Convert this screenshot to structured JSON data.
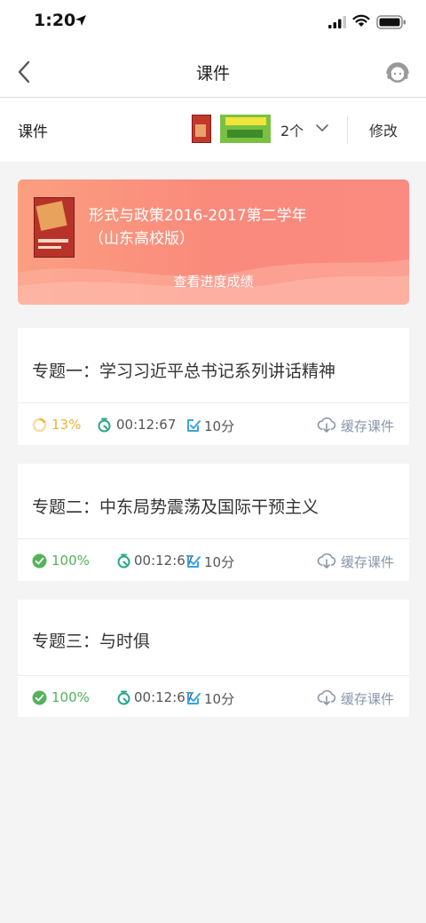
{
  "status_bar": {
    "time": "1:20"
  },
  "nav": {
    "title": "课件"
  },
  "course_bar": {
    "label": "课件",
    "count": "2个",
    "edit_label": "修改"
  },
  "banner": {
    "title_line1": "形式与政策2016-2017第二学年",
    "title_line2": "（山东高校版）",
    "link_text": "查看进度成绩"
  },
  "topics": [
    {
      "title": "专题一：学习习近平总书记系列讲话精神",
      "progress": "13%",
      "duration": "00:12:67",
      "score": "10分",
      "cache_label": "缓存课件"
    },
    {
      "title": "专题二：中东局势震荡及国际干预主义",
      "progress": "100%",
      "duration": "00:12:67",
      "score": "10分",
      "cache_label": "缓存课件"
    },
    {
      "title": "专题三：与时俱",
      "progress": "100%",
      "duration": "00:12:67",
      "score": "10分",
      "cache_label": "缓存课件"
    }
  ],
  "icons": {
    "back": "chevron-left-icon",
    "service": "customer-service-icon",
    "dropdown": "chevron-down-icon",
    "progress_partial": "progress-ring-icon",
    "progress_done": "check-circle-icon",
    "timer": "stopwatch-icon",
    "score": "edit-score-icon",
    "cache": "cloud-download-icon"
  },
  "colors": {
    "banner_start": "#fb9e80",
    "banner_end": "#fa8a7c",
    "progress_partial": "#f2b237",
    "progress_done": "#54b259",
    "timer": "#2aa889",
    "score": "#3aa3e3",
    "cache": "#8a95a8"
  }
}
